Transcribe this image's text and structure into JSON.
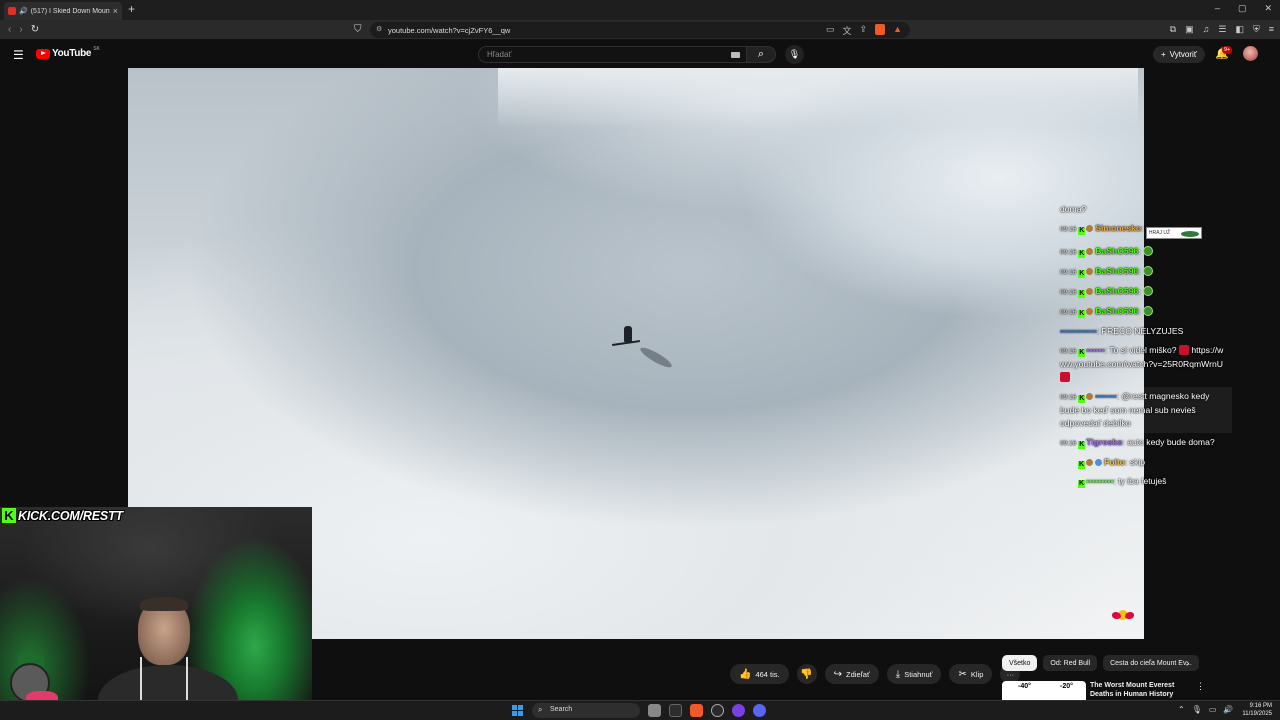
{
  "browser": {
    "tab_title": "(517) I Skied Down Mount Ev...",
    "new_tab": "+",
    "url": "youtube.com/watch?v=cjZvFY6__qw",
    "window_controls": [
      "–",
      "▢",
      "✕"
    ]
  },
  "youtube": {
    "logo_text": "YouTube",
    "logo_country": "SK",
    "search_placeholder": "Hľadať",
    "create_label": "Vytvoriť",
    "notif_badge": "9+"
  },
  "chat": {
    "messages": [
      {
        "time": "",
        "user": "",
        "text": "doma?"
      },
      {
        "time": "09:16",
        "user": "Simonesko",
        "text": ":",
        "sticker": "HRAJ UŽ"
      },
      {
        "time": "09:16",
        "user": "BaShO596",
        "text": ":"
      },
      {
        "time": "09:16",
        "user": "BaShO596",
        "text": ":"
      },
      {
        "time": "09:16",
        "user": "BaShO596",
        "text": ":"
      },
      {
        "time": "09:16",
        "user": "BaShO596",
        "text": ":"
      },
      {
        "time": "",
        "user": "",
        "text": ": PRECO NELYZUJES"
      },
      {
        "time": "09:16",
        "user": "",
        "text": "To si videl miško?"
      },
      {
        "time": "",
        "user": "",
        "text": "https://www.youtube.com/watch?v=25R0RqmWrnU"
      },
      {
        "time": "09:16",
        "user": "",
        "text": "@restt magnesko kedy bude bo keď som nemal sub nevieš odpovedať debilko"
      },
      {
        "time": "09:16",
        "user": "Tigrosko",
        "text": ": auto kedy bude doma?"
      },
      {
        "time": "",
        "user": "Folto",
        "text": ": skip"
      },
      {
        "time": "",
        "user": "",
        "text": ": ty iba fetuješ"
      }
    ]
  },
  "overlay": {
    "kick_letter": "K",
    "kick_url": "KICK.COM/RESTT"
  },
  "actions": {
    "likes": "464 tis.",
    "share": "Zdieľať",
    "download": "Stiahnuť",
    "clip": "Klip",
    "more": "···"
  },
  "chips": [
    "Všetko",
    "Od: Red Bull",
    "Cesta do cieľa Mount Ev..."
  ],
  "recommendation": {
    "thumb_left": "-40°",
    "thumb_right": "-20°",
    "title": "The Worst Mount Everest Deaths in Human History"
  },
  "taskbar": {
    "search_label": "Search",
    "time": "9:16 PM",
    "date": "11/19/2025"
  },
  "colors": {
    "kick_green": "#53fc18",
    "yt_red": "#ff0000",
    "bg": "#0f0f0f"
  }
}
